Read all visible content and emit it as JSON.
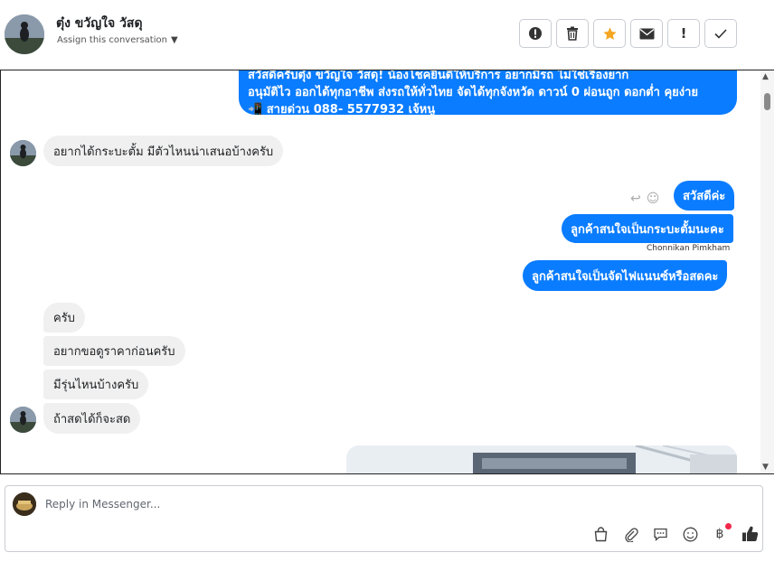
{
  "header": {
    "contact_name": "ตุ๋ง ขวัญใจ วัสดุ",
    "assign_label": "Assign this conversation",
    "actions": {
      "spam": "spam-icon",
      "delete": "trash-icon",
      "star": "star-icon",
      "unread": "mail-icon",
      "follow_up": "!",
      "done": "check-icon"
    },
    "star_color": "#f5a623"
  },
  "thread": {
    "greeting": {
      "line1": "สวัสดีครับตุ๋ง ขวัญใจ วัสดุ! น้องโชคยินดีให้บริการ อยากมีรถ ไม่ใช่เรื่องยาก",
      "line2": "อนุมัติไว ออกได้ทุกอาชีพ ส่งรถให้ทั่วไทย จัดได้ทุกจังหวัด ดาวน์ 0  ผ่อนถูก ดอกต่ำ คุยง่าย",
      "line3": "📲 สายด่วน 088- 5577932 เจ้หนู"
    },
    "msg_in_1": "อยากได้กระบะตั้ม มีตัวไหนน่าเสนอบ้างครับ",
    "msg_out_1": "สวัสดีค่ะ",
    "msg_out_2": "ลูกค้าสนใจเป็นกระบะตั้มนะคะ",
    "sender_name": "Chonnikan Pimkham",
    "msg_out_3": "ลูกค้าสนใจเป็นจัดไฟแนนซ์หรือสดคะ",
    "msg_in_2": "ครับ",
    "msg_in_3": "อยากขอดูราคาก่อนครับ",
    "msg_in_4": "มีรุ่นไหนบ้างครับ",
    "msg_in_5": "ถ้าสดได้ก็จะสด",
    "outgoing_color": "#0a7cff",
    "incoming_color": "#f0f0f0"
  },
  "composer": {
    "placeholder": "Reply in Messenger...",
    "tools": [
      "shop-bag-icon",
      "paperclip-icon",
      "saved-reply-icon",
      "emoji-icon",
      "baht-payment-icon",
      "like-icon"
    ]
  }
}
